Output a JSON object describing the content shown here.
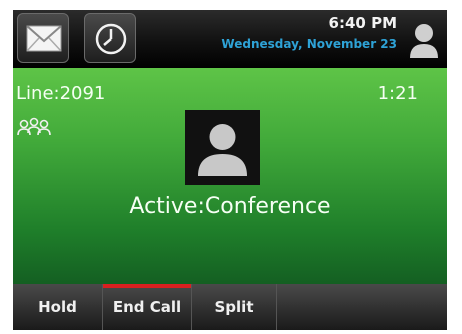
{
  "status": {
    "time": "6:40 PM",
    "date": "Wednesday, November 23"
  },
  "topbar": {
    "buttons": [
      {
        "icon": "envelope-icon"
      },
      {
        "icon": "clock-icon"
      }
    ],
    "user_icon": "user-icon"
  },
  "call": {
    "line": "Line:2091",
    "duration": "1:21",
    "state": "Active:Conference",
    "participants_icon": "conference-icon",
    "avatar_icon": "contact-avatar-icon"
  },
  "softkeys": [
    {
      "label": "Hold"
    },
    {
      "label": "End Call",
      "accent": "#d92020"
    },
    {
      "label": "Split"
    },
    {
      "label": ""
    }
  ],
  "colors": {
    "call_green": "#41a93a",
    "date_blue": "#2ea2d6",
    "end_call_red": "#d92020"
  }
}
